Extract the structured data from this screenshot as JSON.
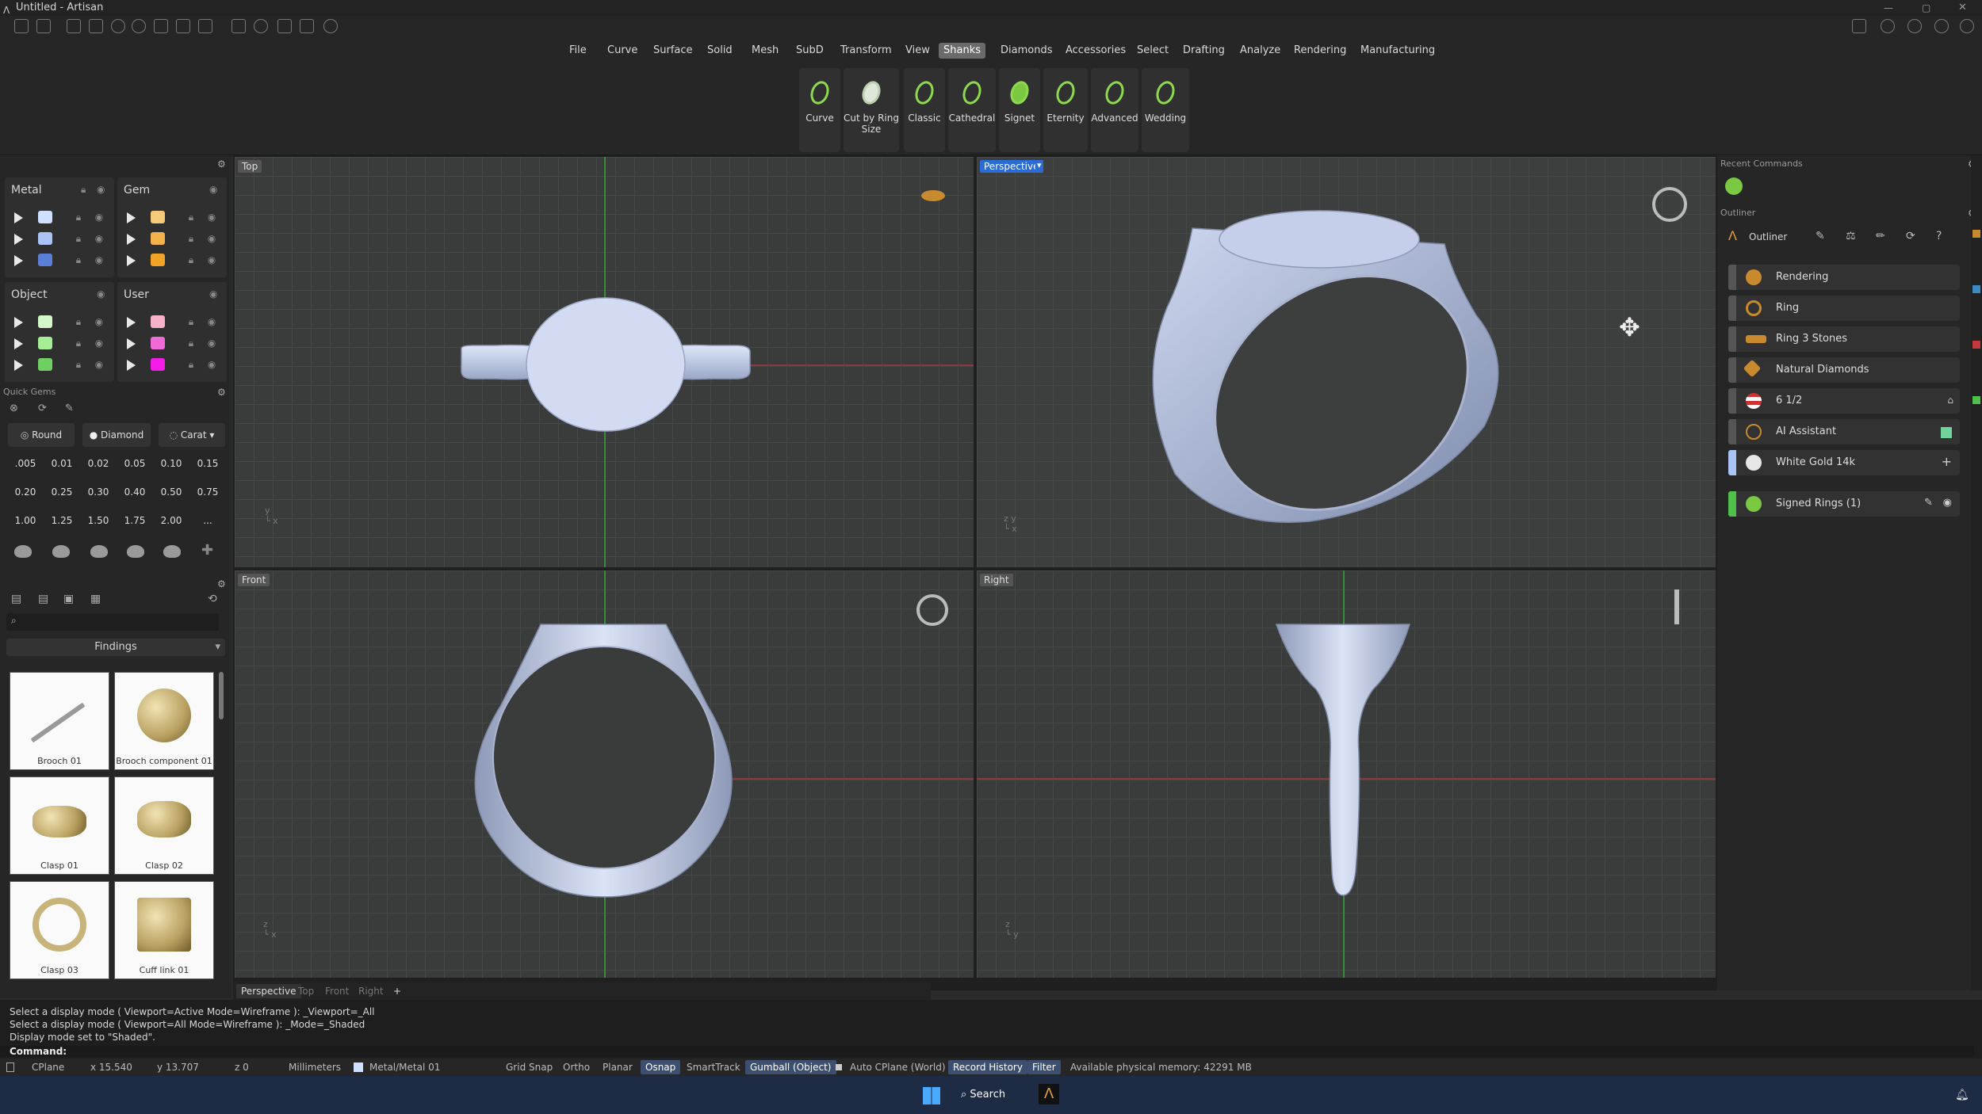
{
  "window": {
    "title": "Untitled - Artisan"
  },
  "menu": [
    "File",
    "Curve",
    "Surface",
    "Solid",
    "Mesh",
    "SubD",
    "Transform",
    "View",
    "Shanks",
    "Diamonds",
    "Accessories",
    "Select",
    "Drafting",
    "Analyze",
    "Rendering",
    "Manufacturing"
  ],
  "menu_active": "Shanks",
  "ribbon": [
    "Curve",
    "Cut by Ring Size",
    "Classic",
    "Cathedral",
    "Signet",
    "Eternity",
    "Advanced",
    "Wedding"
  ],
  "layers": {
    "metal": {
      "label": "Metal",
      "colors": [
        "#cfe0ff",
        "#a9c4f5",
        "#5b7fd6"
      ]
    },
    "gem": {
      "label": "Gem",
      "colors": [
        "#f5c97a",
        "#f2b24a",
        "#f0a326"
      ]
    },
    "object": {
      "label": "Object",
      "colors": [
        "#d3f7c8",
        "#a6ee95",
        "#70cf62"
      ]
    },
    "user": {
      "label": "User",
      "colors": [
        "#f7b1c8",
        "#f06bd7",
        "#f21ce6"
      ]
    }
  },
  "quick_gems": {
    "title": "Quick Gems",
    "shape_label": "Round",
    "type_label": "Diamond",
    "unit_label": "Carat",
    "sizes": [
      ".005",
      "0.01",
      "0.02",
      "0.05",
      "0.10",
      "0.15",
      "0.20",
      "0.25",
      "0.30",
      "0.40",
      "0.50",
      "0.75",
      "1.00",
      "1.25",
      "1.50",
      "1.75",
      "2.00",
      "..."
    ]
  },
  "library": {
    "category": "Findings",
    "items": [
      "Brooch 01",
      "Brooch component 01",
      "Clasp 01",
      "Clasp 02",
      "Clasp 03",
      "Cuff link 01"
    ]
  },
  "viewports": {
    "top": "Top",
    "perspective": "Perspective",
    "front": "Front",
    "right": "Right"
  },
  "bottom_tabs": [
    "Perspective",
    "Top",
    "Front",
    "Right",
    "+"
  ],
  "recent_commands_title": "Recent Commands",
  "outliner": {
    "title": "Outliner",
    "header_label": "Outliner",
    "items": [
      "Rendering",
      "Ring",
      "Ring 3 Stones",
      "Natural Diamonds",
      "6 1/2",
      "AI Assistant",
      "White Gold 14k",
      "Signed Rings (1)"
    ]
  },
  "command_history": [
    "Select a display mode ( Viewport=Active  Mode=Wireframe ): _Viewport=_All",
    "Select a display mode ( Viewport=All  Mode=Wireframe ): _Mode=_Shaded",
    "Display mode set to \"Shaded\"."
  ],
  "command_prompt": "Command:",
  "status": {
    "cplane": "CPlane",
    "x": "x 15.540",
    "y": "y 13.707",
    "z": "z 0",
    "units": "Millimeters",
    "layer": "Metal/Metal 01",
    "toggles": [
      "Grid Snap",
      "Ortho",
      "Planar",
      "Osnap",
      "SmartTrack",
      "Gumball (Object)",
      "Auto CPlane (World)",
      "Record History",
      "Filter"
    ],
    "toggles_on": [
      "Osnap",
      "Gumball (Object)",
      "Record History",
      "Filter"
    ],
    "memory": "Available physical memory: 42291 MB"
  },
  "taskbar": {
    "search": "Search"
  }
}
